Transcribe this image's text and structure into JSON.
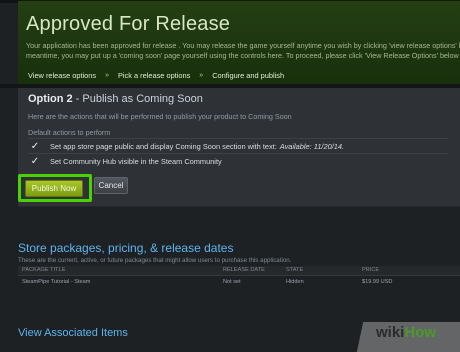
{
  "header": {
    "title": "Approved For Release",
    "intro_line1": "Your application has been approved for release . You may release the game yourself anytime you wish by clicking 'view release options' below and",
    "intro_line2": "meantime, you may put up a 'coming soon' page yourself using the controls here. To proceed, please click 'View Release Options' below for deta"
  },
  "breadcrumb": {
    "items": [
      "View release options",
      "Pick a release options",
      "Configure and publish"
    ],
    "separator": "»"
  },
  "option": {
    "number": "Option 2",
    "title": "Publish as Coming Soon",
    "description": "Here are the actions that will be performed to publish your product to Coming Soon",
    "defaults_label": "Default actions to perform",
    "actions": [
      {
        "text": "Set app store page public and display Coming Soon section with text:",
        "emphasis": "Available: 11/20/14."
      },
      {
        "text": "Set Community Hub visible in the Steam Community",
        "emphasis": ""
      }
    ],
    "publish_label": "Publish Now",
    "cancel_label": "Cancel"
  },
  "store_packages": {
    "title": "Store packages, pricing, & release dates",
    "description": "These are the current, active, or future packages that might allow users to purchase this application.",
    "columns": [
      "PACKAGE TITLE",
      "RELEASE DATE",
      "STATE",
      "PRICE"
    ],
    "rows": [
      [
        "SteamPipe Tutorial - Steam",
        "Not set",
        "Hidden",
        "$19.99 USD"
      ]
    ]
  },
  "associated": {
    "title": "View Associated Items"
  },
  "watermark": {
    "wiki": "wiki",
    "how": "How"
  },
  "colors": {
    "accent_green": "#4cd100",
    "link_blue": "#5db4ee",
    "publish_button": "#8fb01e"
  }
}
